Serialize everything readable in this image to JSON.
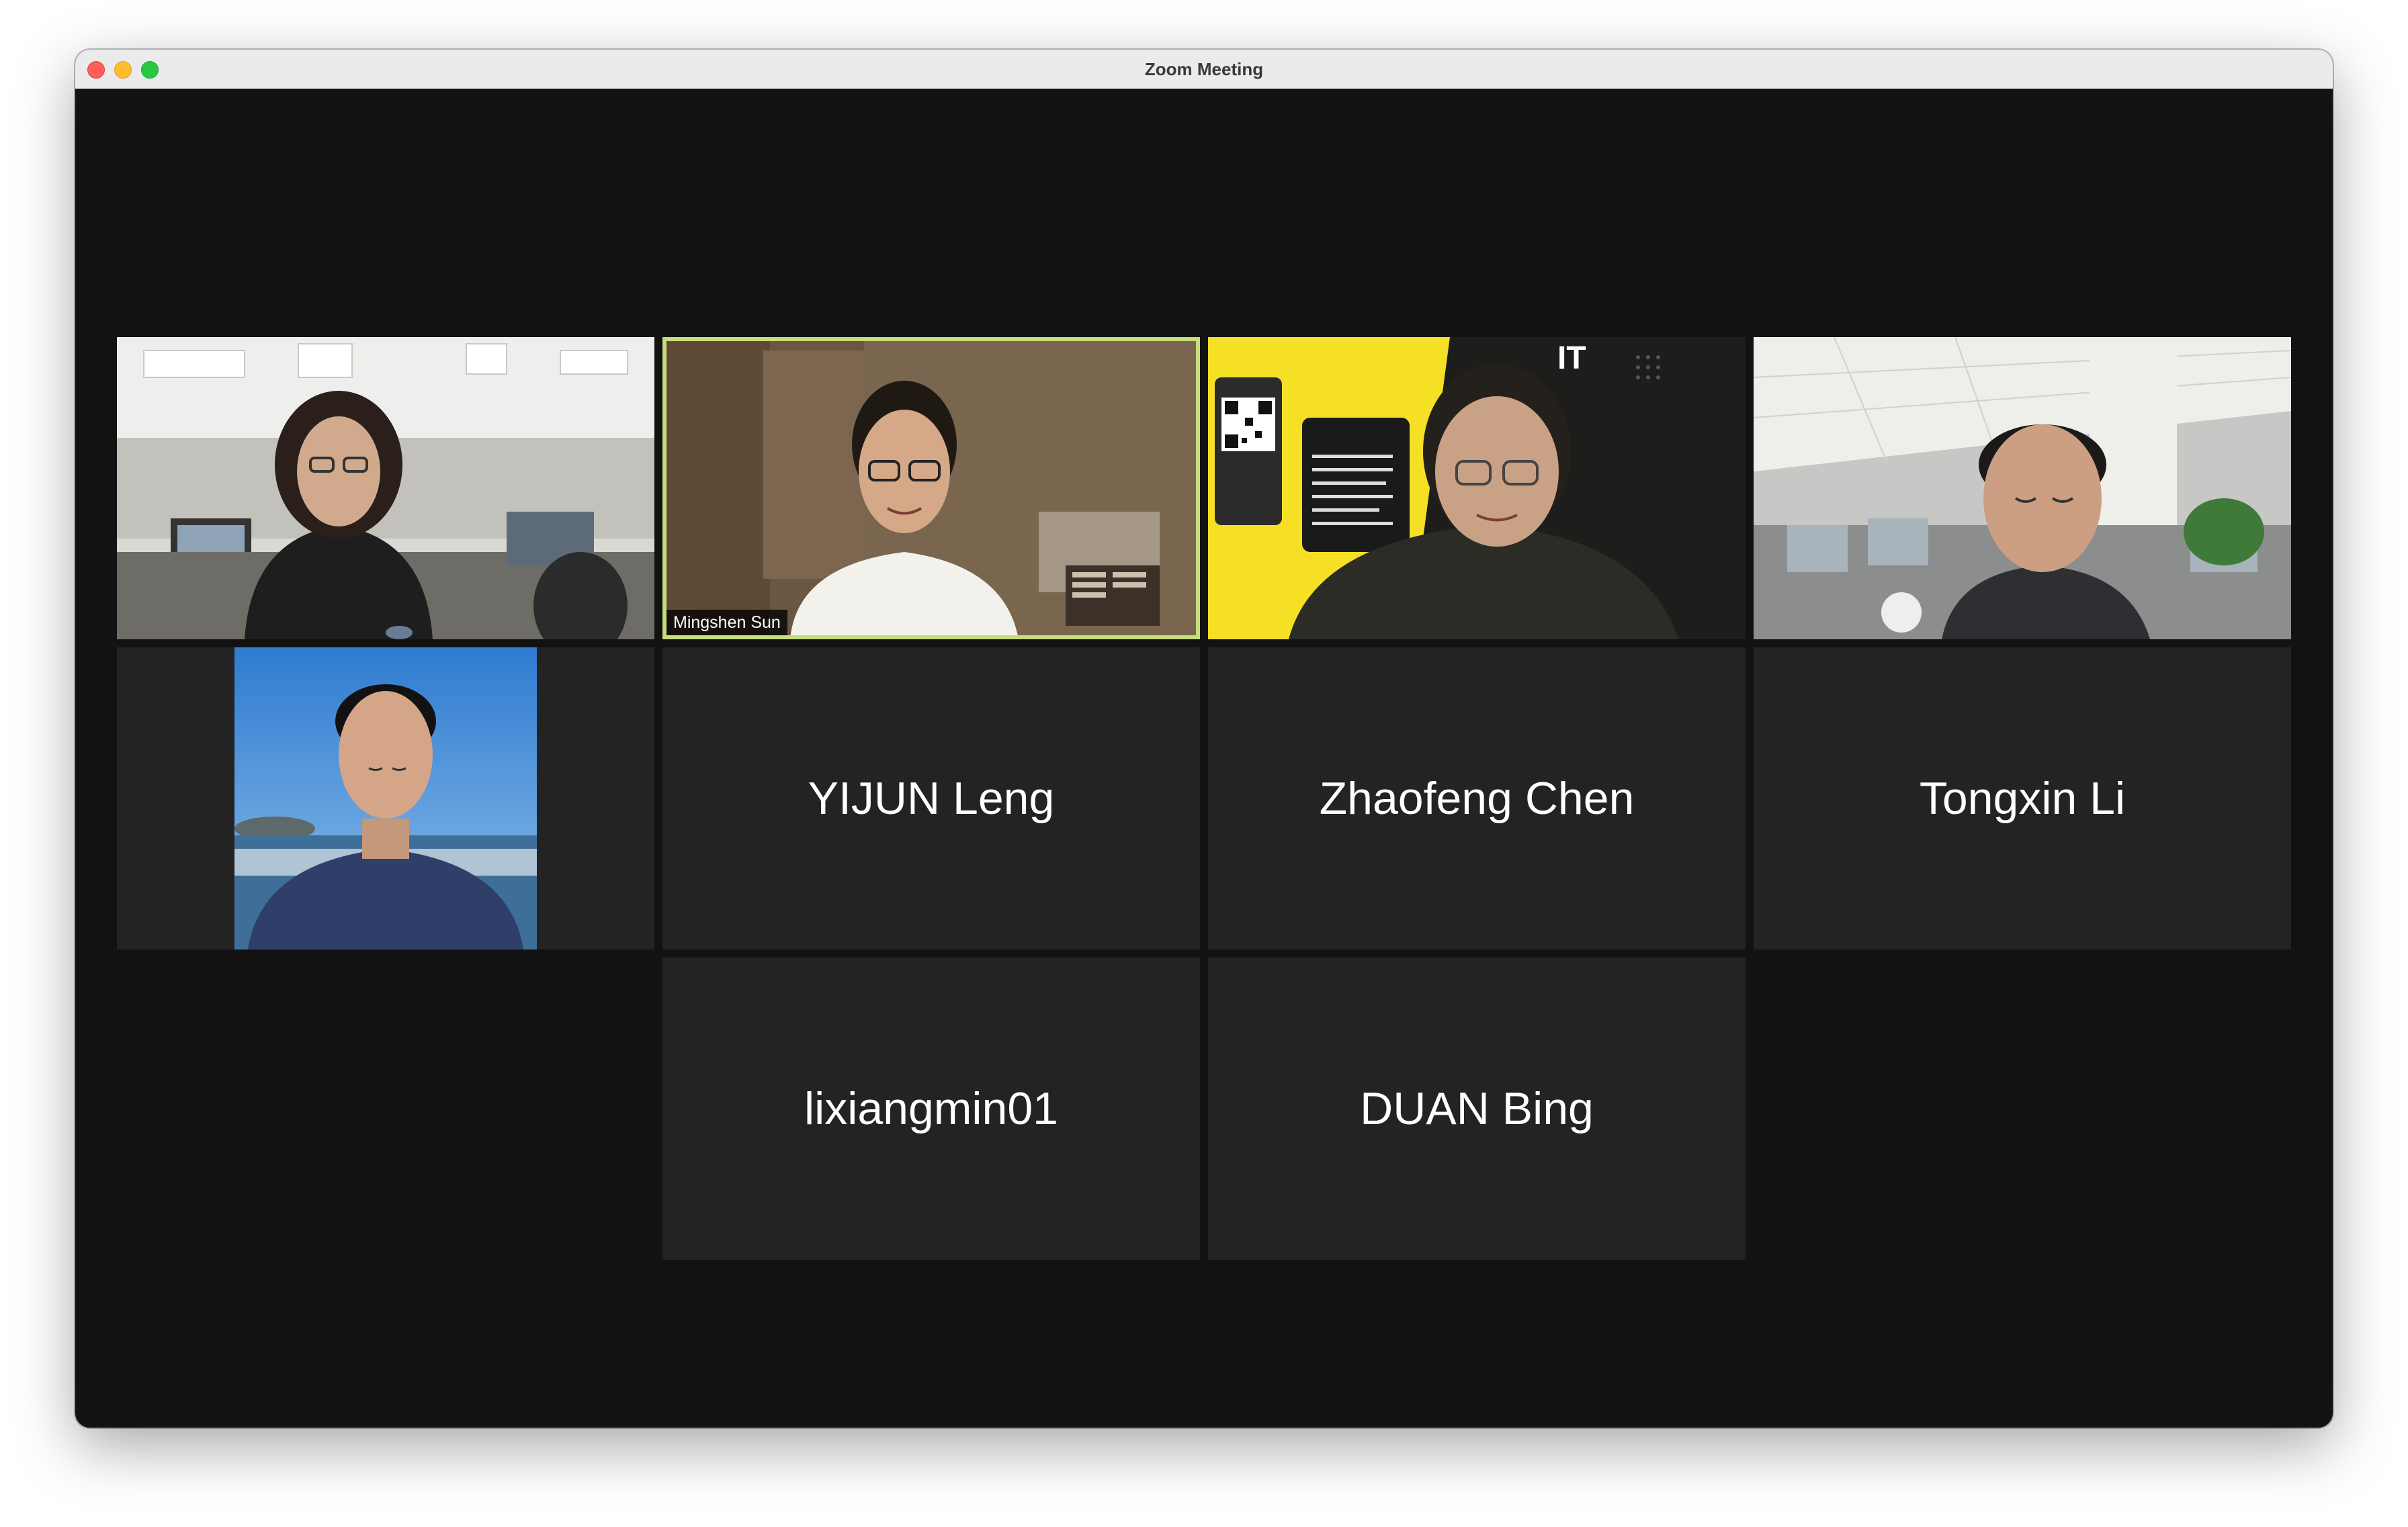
{
  "window": {
    "title": "Zoom Meeting"
  },
  "participants": [
    {
      "name": "",
      "has_video": true
    },
    {
      "name": "Mingshen Sun",
      "has_video": true,
      "active_speaker": true
    },
    {
      "name": "",
      "has_video": true
    },
    {
      "name": "",
      "has_video": true
    },
    {
      "name": "",
      "has_profile_picture": true
    },
    {
      "name": "YIJUN Leng",
      "has_video": false
    },
    {
      "name": "Zhaofeng Chen",
      "has_video": false
    },
    {
      "name": "Tongxin Li",
      "has_video": false
    },
    {
      "name": "lixiangmin01",
      "has_video": false
    },
    {
      "name": "DUAN Bing",
      "has_video": false
    }
  ],
  "video_overlays": {
    "poster_text": "IT"
  },
  "colors": {
    "active_speaker_border": "#c6dd7a",
    "tile_background": "#232323",
    "stage_background": "#121212",
    "poster_yellow": "#f6e025"
  }
}
